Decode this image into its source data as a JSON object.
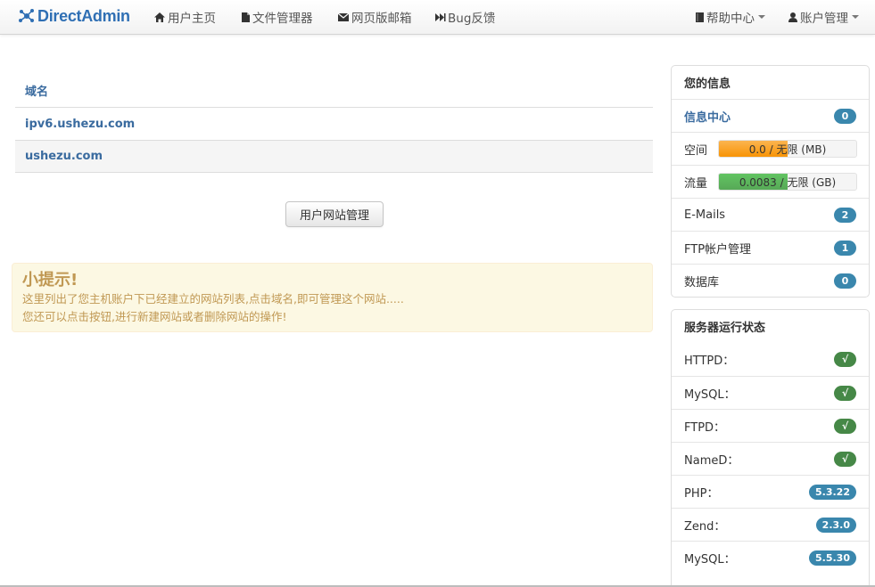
{
  "brand": {
    "name": "DirectAdmin"
  },
  "nav": {
    "home": "用户主页",
    "files": "文件管理器",
    "mail": "网页版邮箱",
    "bug": "Bug反馈",
    "help": "帮助中心",
    "account": "账户管理"
  },
  "domains": {
    "header": "域名",
    "items": [
      "ipv6.ushezu.com",
      "ushezu.com"
    ]
  },
  "manage_button": "用户网站管理",
  "tip": {
    "title": "小提示!",
    "line1": "这里列出了您主机账户下已经建立的网站列表,点击域名,即可管理这个网站.....",
    "line2": "您还可以点击按钮,进行新建网站或者删除网站的操作!"
  },
  "info_panel": {
    "title": "您的信息",
    "info_center": {
      "label": "信息中心",
      "badge": "0"
    },
    "space": {
      "label": "空间",
      "text": "0.0 / 无限 (MB)",
      "fill_fraction": 0.5
    },
    "traffic": {
      "label": "流量",
      "text": "0.0083 / 无限 (GB)",
      "fill_fraction": 0.5
    },
    "emails": {
      "label": "E-Mails",
      "badge": "2"
    },
    "ftp": {
      "label": "FTP帐户管理",
      "badge": "1"
    },
    "db": {
      "label": "数据库",
      "badge": "0"
    }
  },
  "status_panel": {
    "title": "服务器运行状态",
    "rows": [
      {
        "label": "HTTPD：",
        "value": "√",
        "color": "#468847"
      },
      {
        "label": "MySQL：",
        "value": "√",
        "color": "#468847"
      },
      {
        "label": "FTPD：",
        "value": "√",
        "color": "#468847"
      },
      {
        "label": "NameD：",
        "value": "√",
        "color": "#468847"
      },
      {
        "label": "PHP：",
        "value": "5.3.22",
        "color": "#3a87ad"
      },
      {
        "label": "Zend：",
        "value": "2.3.0",
        "color": "#3a87ad"
      },
      {
        "label": "MySQL：",
        "value": "5.5.30",
        "color": "#3a87ad"
      }
    ]
  }
}
